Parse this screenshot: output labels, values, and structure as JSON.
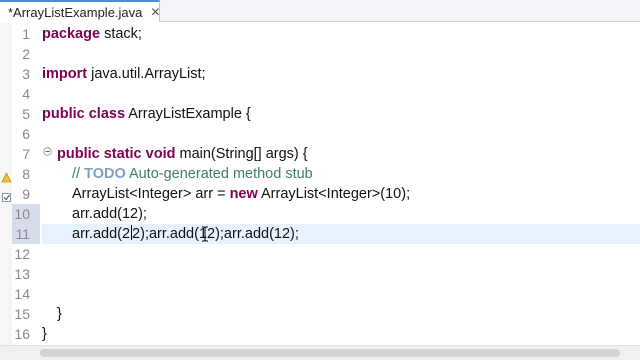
{
  "tab": {
    "label": "*ArrayListExample.java",
    "close": "✕"
  },
  "gutter": {
    "line_numbers": [
      "1",
      "2",
      "3",
      "4",
      "5",
      "6",
      "7",
      "8",
      "9",
      "10",
      "11",
      "12",
      "13",
      "14",
      "15",
      "16"
    ]
  },
  "code": {
    "l1_kw": "package",
    "l1_rest": " stack;",
    "l3_kw": "import",
    "l3_rest": " java.util.ArrayList;",
    "l5_kw1": "public",
    "l5_kw2": "class",
    "l5_rest": " ArrayListExample {",
    "l7_kw1": "public",
    "l7_kw2": "static",
    "l7_kw3": "void",
    "l7_rest": " main(String[] args) {",
    "l8_cm": "// ",
    "l8_todo": "TODO",
    "l8_rest": " Auto-generated method stub",
    "l9_a": "ArrayList<Integer> arr = ",
    "l9_kw": "new",
    "l9_b": " ArrayList<Integer>(10);",
    "l10": "arr.add(12);",
    "l11_a": "arr.add(2",
    "l11_b": "2);arr.add(12);arr.add(12);",
    "l14": "}",
    "l16": "}"
  },
  "colors": {
    "keyword": "#7f0055",
    "comment": "#3f7f5f",
    "todo": "#7f9fbf",
    "current_line": "#e8f2fe",
    "tab_accent": "#4a8fd6"
  }
}
